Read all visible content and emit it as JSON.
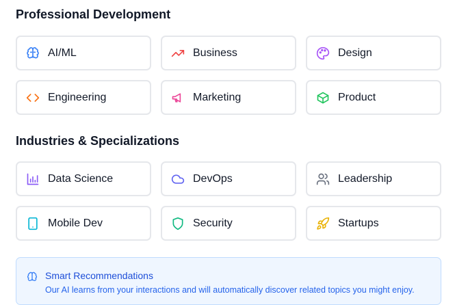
{
  "sections": [
    {
      "title": "Professional Development",
      "items": [
        {
          "label": "AI/ML",
          "icon": "brain-icon",
          "color": "#3b82f6"
        },
        {
          "label": "Business",
          "icon": "trending-up-icon",
          "color": "#ef4444"
        },
        {
          "label": "Design",
          "icon": "palette-icon",
          "color": "#a855f7"
        },
        {
          "label": "Engineering",
          "icon": "code-icon",
          "color": "#f97316"
        },
        {
          "label": "Marketing",
          "icon": "megaphone-icon",
          "color": "#ec4899"
        },
        {
          "label": "Product",
          "icon": "package-icon",
          "color": "#22c55e"
        }
      ]
    },
    {
      "title": "Industries & Specializations",
      "items": [
        {
          "label": "Data Science",
          "icon": "bar-chart-icon",
          "color": "#8b5cf6"
        },
        {
          "label": "DevOps",
          "icon": "cloud-icon",
          "color": "#6366f1"
        },
        {
          "label": "Leadership",
          "icon": "users-icon",
          "color": "#6b7280"
        },
        {
          "label": "Mobile Dev",
          "icon": "smartphone-icon",
          "color": "#06b6d4"
        },
        {
          "label": "Security",
          "icon": "shield-icon",
          "color": "#10b981"
        },
        {
          "label": "Startups",
          "icon": "rocket-icon",
          "color": "#eab308"
        }
      ]
    }
  ],
  "recommendation": {
    "title": "Smart Recommendations",
    "description": "Our AI learns from your interactions and will automatically discover related topics you might enjoy.",
    "icon": "brain-icon",
    "color": "#3b82f6"
  }
}
